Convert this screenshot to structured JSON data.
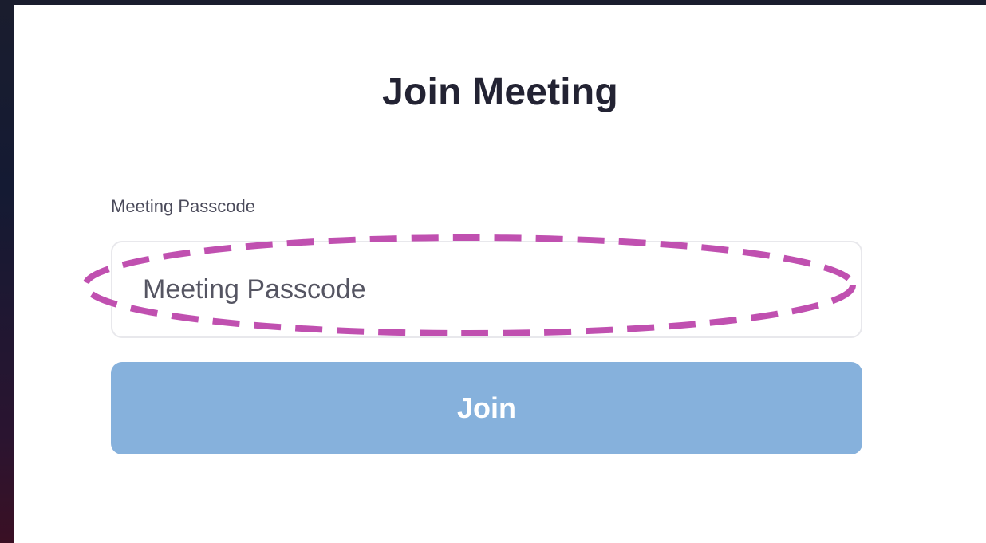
{
  "dialog": {
    "title": "Join Meeting",
    "passcode_label": "Meeting Passcode",
    "passcode_placeholder": "Meeting Passcode",
    "passcode_value": "",
    "join_label": "Join"
  },
  "colors": {
    "button_bg": "#86b1dc",
    "button_text": "#ffffff",
    "annotation_highlight": "#c050b0",
    "title_text": "#232333"
  },
  "annotation": {
    "shape": "dashed-ellipse",
    "target": "passcode-input"
  }
}
